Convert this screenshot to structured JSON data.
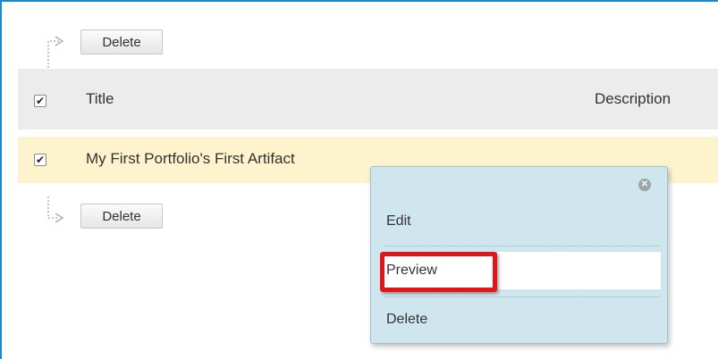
{
  "actions": {
    "top_delete_label": "Delete",
    "bottom_delete_label": "Delete"
  },
  "table": {
    "columns": [
      "Title",
      "Description"
    ],
    "header_checked": true,
    "rows": [
      {
        "title": "My First Portfolio's First Artifact",
        "checked": true
      }
    ]
  },
  "context_menu": {
    "items": [
      {
        "label": "Edit"
      },
      {
        "label": "Preview",
        "highlighted": true
      },
      {
        "label": "Delete"
      }
    ]
  },
  "colors": {
    "frame_border": "#1f86c8",
    "header_bg": "#ececec",
    "row_bg": "#fdf3cc",
    "menu_bg": "#cfe6ef",
    "highlight": "#e3151b"
  }
}
